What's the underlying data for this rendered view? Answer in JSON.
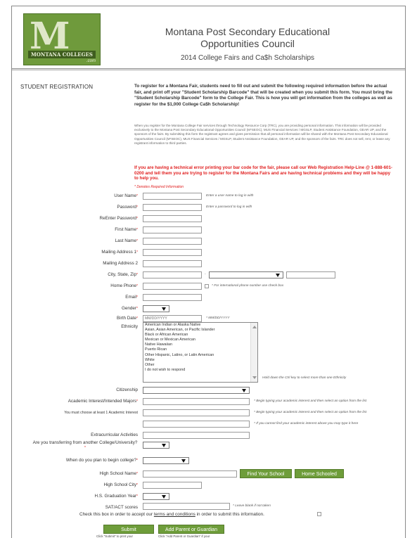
{
  "header": {
    "logo_text": "M",
    "logo_band": "MONTANA COLLEGES",
    "logo_com": ".com",
    "org_title": "Montana Post Secondary Educational Opportunities Council",
    "subtitle": "2014 College Fairs and Ca$h Scholarships"
  },
  "section": {
    "label": "STUDENT REGISTRATION",
    "intro": "To register for a Montana Fair, students need to fill out and submit the following required information before the actual fair, and print off your \"Student Scholarship Barcode\" that will be created when you submit this form. You must bring the \"Student Scholarship Barcode\" form to the College Fair. This is how you will get information from the colleges as well as register for the $1,000 College Ca$h Scholarship!",
    "legal": "When you register for the Montana College Fair services through Technology Resource Corp (TRC), you are providing personal information. This information will be provided exclusively to the Montana Post Secondary Educational Opportunities Council (M*SEOC), MUS Financial Services / MGSLP, Student Assistance Foundation, GEAR UP, and the sponsors of the fairs. By submitting this form the registrant agrees and gives permission that all personal information will be shared with the Montana Post Secondary Educational Opportunities Council (M*SEOC), MUS Financial Services / MGSLP, Student Assistance Foundation, GEAR UP, and the sponsors of the fairs. TRC does not sell, rent, or lease any registrant information to third parties.",
    "warning": "If you are having a technical error printing your bar code for the fair, please call our Web Registration Help-Line @ 1-888-601-0200 and tell them you are trying to register for the Montana Fairs and are having technical problems and they will be happy to help you.",
    "required_note": "* Denotes Required Information"
  },
  "fields": {
    "username": {
      "label": "User Name",
      "hint": "Enter a user name to log in with"
    },
    "password": {
      "label": "Password",
      "hint": "Enter a password to log in with"
    },
    "reenter_password": {
      "label": "ReEnter Password"
    },
    "first_name": {
      "label": "First Name"
    },
    "last_name": {
      "label": "Last Name"
    },
    "mailing1": {
      "label": "Mailing Address 1"
    },
    "mailing2": {
      "label": "Mailing Address 2"
    },
    "city_state_zip": {
      "label": "City, State, Zip",
      "dash": "-"
    },
    "home_phone": {
      "label": "Home Phone",
      "hint": "* For international phone number use check box"
    },
    "email": {
      "label": "Email"
    },
    "gender": {
      "label": "Gender"
    },
    "birth_date": {
      "label": "Birth Date",
      "placeholder": "MM/DD/YYYY",
      "hint": "* MM/DD/YYYY"
    },
    "ethnicity": {
      "label": "Ethnicity",
      "options": [
        "American Indian or Alaska Native",
        "Asian, Asian American, or Pacific Islander",
        "Black or African American",
        "Mexican or Mexican American",
        "Native Hawaiian",
        "Puerto Rican",
        "Other Hispanic, Latino, or Latin American",
        "White",
        "Other",
        "I do not wish to respond"
      ],
      "hint": "Hold down the Ctrl key to select more than one Ethnicity"
    },
    "citizenship": {
      "label": "Citizenship"
    },
    "academic": {
      "label": "Academic Interest/Intended Majors",
      "label2": "You must choose at least 1 Academic Interest",
      "hint1": "* Begin typing your academic interest and then select an option from the list",
      "hint2": "* Begin typing your academic interest and then select an option from the list",
      "hint3": "* If you cannot find your academic interest above you may type it here"
    },
    "extracurricular": {
      "label": "Extracurricular Activities"
    },
    "transfer": {
      "label": "Are you transferring from another College/University?"
    },
    "begin": {
      "label": "When do you plan to begin college?"
    },
    "high_school": {
      "label": "High School Name",
      "find_button": "Find Your School",
      "home_button": "Home Schooled"
    },
    "hs_city": {
      "label": "High School City"
    },
    "hs_grad": {
      "label": "H.S. Graduation Year"
    },
    "sat_act": {
      "label": "SAT/ACT scores",
      "hint": "* Leave blank if not taken"
    },
    "terms": {
      "before": "Check this box in order to accept our ",
      "link": "terms and conditions",
      "after": " in order to submit this information."
    }
  },
  "buttons": {
    "submit": "Submit",
    "add_parent": "Add Parent or Guardian",
    "submit_note": "Click \"Submit\" to print your",
    "add_parent_note": "Click \"Add Parent or Guardian\" if your"
  },
  "colors": {
    "brand_green": "#6e9d3a",
    "required_red": "#e02020"
  }
}
